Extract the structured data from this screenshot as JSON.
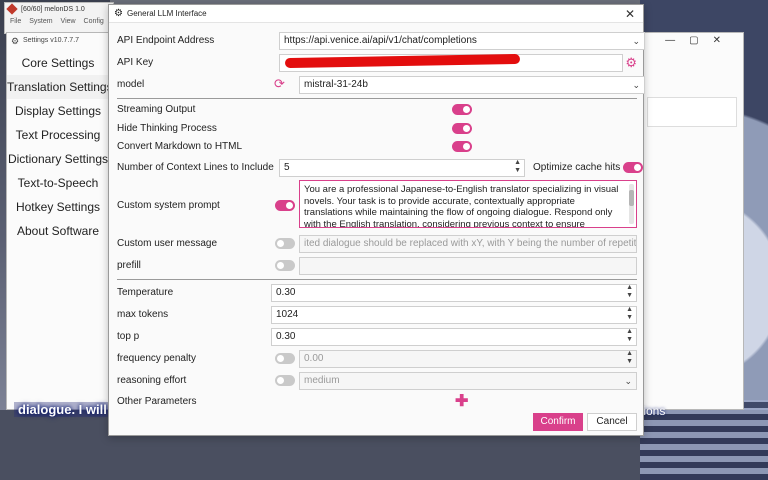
{
  "melonds": {
    "title": "[60/60] melonDS 1.0",
    "menu": [
      "File",
      "System",
      "View",
      "Config"
    ]
  },
  "settings": {
    "title": "Settings v10.7.7.7",
    "nav": [
      "Core Settings",
      "Translation Settings",
      "Display Settings",
      "Text Processing",
      "Dictionary Settings",
      "Text-to-Speech",
      "Hotkey Settings",
      "About Software"
    ],
    "active_index": 1
  },
  "background": {
    "subtitle_left": "dialogue. I will try",
    "subtitle_right": "tions"
  },
  "dialog": {
    "title": "General LLM Interface",
    "api_endpoint": {
      "label": "API Endpoint Address",
      "value": "https://api.venice.ai/api/v1/chat/completions"
    },
    "api_key": {
      "label": "API Key"
    },
    "model": {
      "label": "model",
      "value": "mistral-31-24b"
    },
    "streaming": {
      "label": "Streaming Output",
      "on": true
    },
    "hide_thinking": {
      "label": "Hide Thinking Process",
      "on": true
    },
    "markdown": {
      "label": "Convert Markdown to HTML",
      "on": true
    },
    "context_lines": {
      "label": "Number of Context Lines to Include",
      "value": "5"
    },
    "optimize_cache": {
      "label": "Optimize cache hits",
      "on": true
    },
    "system_prompt": {
      "label": "Custom system prompt",
      "on": true,
      "text": "You are a professional Japanese-to-English translator specializing in visual novels. Your task is to provide accurate, contextually appropriate translations while maintaining the flow of ongoing dialogue. Respond only with the English translation, considering previous context to ensure consistency in"
    },
    "user_message": {
      "label": "Custom user message",
      "on": false,
      "placeholder": "ited dialogue should be replaced with xY, with Y being the number of repetitions."
    },
    "prefill": {
      "label": "prefill",
      "on": false,
      "value": ""
    },
    "temperature": {
      "label": "Temperature",
      "value": "0.30"
    },
    "max_tokens": {
      "label": "max tokens",
      "value": "1024"
    },
    "top_p": {
      "label": "top p",
      "value": "0.30"
    },
    "frequency_penalty": {
      "label": "frequency penalty",
      "on": false,
      "value": "0.00"
    },
    "reasoning_effort": {
      "label": "reasoning effort",
      "on": false,
      "value": "medium"
    },
    "other_params": {
      "label": "Other Parameters"
    },
    "confirm_label": "Confirm",
    "cancel_label": "Cancel"
  },
  "colors": {
    "accent": "#d9408b",
    "redaction": "#e30d0d"
  }
}
